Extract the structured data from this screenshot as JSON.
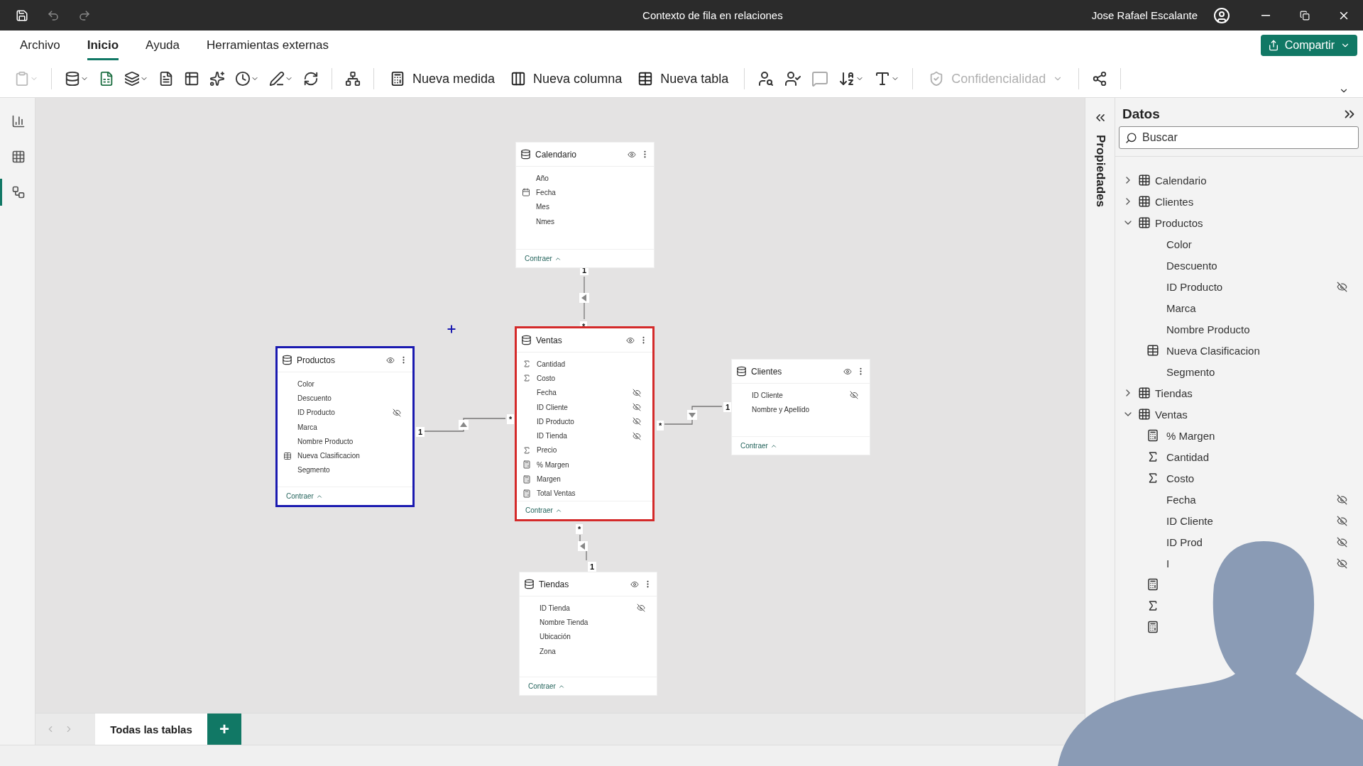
{
  "window": {
    "title": "Contexto de fila en relaciones",
    "user": "Jose Rafael Escalante"
  },
  "ribbon_tabs": [
    {
      "label": "Archivo",
      "selected": false
    },
    {
      "label": "Inicio",
      "selected": true
    },
    {
      "label": "Ayuda",
      "selected": false
    },
    {
      "label": "Herramientas externas",
      "selected": false
    }
  ],
  "share_button": "Compartir",
  "toolbar": [
    {
      "label": "Nueva medida",
      "disabled": false
    },
    {
      "label": "Nueva columna",
      "disabled": false
    },
    {
      "label": "Nueva tabla",
      "disabled": false
    },
    {
      "label": "Confidencialidad",
      "disabled": true
    }
  ],
  "left_nav": [
    {
      "selected": false
    },
    {
      "selected": false
    },
    {
      "selected": true
    }
  ],
  "model": {
    "tables": [
      {
        "name": "Calendario",
        "fields": [
          {
            "name": "Año",
            "kind": "plain",
            "hidden": false
          },
          {
            "name": "Fecha",
            "kind": "date",
            "hidden": false
          },
          {
            "name": "Mes",
            "kind": "plain",
            "hidden": false
          },
          {
            "name": "Nmes",
            "kind": "plain",
            "hidden": false
          }
        ],
        "footer": "Contraer"
      },
      {
        "name": "Productos",
        "color": "#1a1ab0",
        "fields": [
          {
            "name": "Color",
            "kind": "plain",
            "hidden": false
          },
          {
            "name": "Descuento",
            "kind": "plain",
            "hidden": false
          },
          {
            "name": "ID Producto",
            "kind": "plain",
            "hidden": true
          },
          {
            "name": "Marca",
            "kind": "plain",
            "hidden": false
          },
          {
            "name": "Nombre Producto",
            "kind": "plain",
            "hidden": false
          },
          {
            "name": "Nueva Clasificacion",
            "kind": "calc-column",
            "hidden": false
          },
          {
            "name": "Segmento",
            "kind": "plain",
            "hidden": false
          }
        ],
        "footer": "Contraer"
      },
      {
        "name": "Ventas",
        "color": "#d42a2a",
        "fields": [
          {
            "name": "Cantidad",
            "kind": "sum",
            "hidden": false
          },
          {
            "name": "Costo",
            "kind": "sum",
            "hidden": false
          },
          {
            "name": "Fecha",
            "kind": "plain",
            "hidden": true
          },
          {
            "name": "ID Cliente",
            "kind": "plain",
            "hidden": true
          },
          {
            "name": "ID Producto",
            "kind": "plain",
            "hidden": true
          },
          {
            "name": "ID Tienda",
            "kind": "plain",
            "hidden": true
          },
          {
            "name": "Precio",
            "kind": "sum",
            "hidden": false
          },
          {
            "name": "% Margen",
            "kind": "measure",
            "hidden": false
          },
          {
            "name": "Margen",
            "kind": "measure",
            "hidden": false
          },
          {
            "name": "Total Ventas",
            "kind": "measure",
            "hidden": false
          }
        ],
        "footer": "Contraer"
      },
      {
        "name": "Clientes",
        "fields": [
          {
            "name": "ID Cliente",
            "kind": "plain",
            "hidden": true
          },
          {
            "name": "Nombre y Apellido",
            "kind": "plain",
            "hidden": false
          }
        ],
        "footer": "Contraer"
      },
      {
        "name": "Tiendas",
        "fields": [
          {
            "name": "ID Tienda",
            "kind": "plain",
            "hidden": true
          },
          {
            "name": "Nombre Tienda",
            "kind": "plain",
            "hidden": false
          },
          {
            "name": "Ubicación",
            "kind": "plain",
            "hidden": false
          },
          {
            "name": "Zona",
            "kind": "plain",
            "hidden": false
          }
        ],
        "footer": "Contraer"
      }
    ],
    "relationships": [
      {
        "one": "1",
        "many": "*"
      },
      {
        "one": "1",
        "many": "*"
      },
      {
        "one": "1",
        "many": "*"
      },
      {
        "one": "1",
        "many": "*"
      }
    ]
  },
  "page_tabs": [
    {
      "label": "Todas las tablas",
      "selected": true
    }
  ],
  "add_page": "+",
  "properties_pane": {
    "title": "Propiedades"
  },
  "data_pane": {
    "title": "Datos",
    "search": {
      "placeholder": "Buscar"
    },
    "tree": [
      {
        "name": "Calendario",
        "expanded": false
      },
      {
        "name": "Clientes",
        "expanded": false
      },
      {
        "name": "Productos",
        "expanded": true,
        "children": [
          {
            "name": "Color",
            "kind": "plain",
            "hidden": false
          },
          {
            "name": "Descuento",
            "kind": "plain",
            "hidden": false
          },
          {
            "name": "ID Producto",
            "kind": "plain",
            "hidden": true
          },
          {
            "name": "Marca",
            "kind": "plain",
            "hidden": false
          },
          {
            "name": "Nombre Producto",
            "kind": "plain",
            "hidden": false
          },
          {
            "name": "Nueva Clasificacion",
            "kind": "calc-column",
            "hidden": false
          },
          {
            "name": "Segmento",
            "kind": "plain",
            "hidden": false
          }
        ]
      },
      {
        "name": "Tiendas",
        "expanded": false
      },
      {
        "name": "Ventas",
        "expanded": true,
        "children": [
          {
            "name": "% Margen",
            "kind": "measure",
            "hidden": false
          },
          {
            "name": "Cantidad",
            "kind": "sum",
            "hidden": false
          },
          {
            "name": "Costo",
            "kind": "sum",
            "hidden": false
          },
          {
            "name": "Fecha",
            "kind": "plain",
            "hidden": true
          },
          {
            "name": "ID Cliente",
            "kind": "plain",
            "hidden": true
          },
          {
            "name": "ID Prod",
            "kind": "plain",
            "hidden": true
          },
          {
            "name": "I",
            "kind": "plain",
            "hidden": true
          },
          {
            "kind": "measure",
            "hidden": false
          },
          {
            "kind": "sum",
            "hidden": false
          },
          {
            "kind": "measure",
            "hidden": false
          }
        ]
      }
    ]
  }
}
